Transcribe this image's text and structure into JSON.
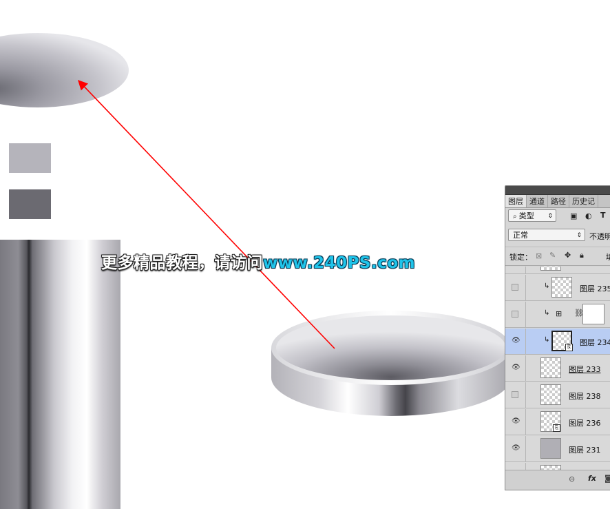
{
  "watermark": {
    "text_cn": "更多精品教程，请访问",
    "text_url": "www.240PS.com",
    "url_color": "#1fc4ea"
  },
  "swatches": [
    {
      "name": "light-gray",
      "color": "#b5b4bb"
    },
    {
      "name": "dark-gray",
      "color": "#6b6a71"
    }
  ],
  "arrow": {
    "color": "#ff0000"
  },
  "layers_panel": {
    "tabs": [
      {
        "label": "图层",
        "active": true
      },
      {
        "label": "通道",
        "active": false
      },
      {
        "label": "路径",
        "active": false
      },
      {
        "label": "历史记",
        "active": false
      }
    ],
    "filter_label": "类型",
    "blend_mode": "正常",
    "opacity_label": "不透明",
    "lock_label": "锁定：",
    "fill_label": "填",
    "layers": [
      {
        "name": "图层 235",
        "visible": false,
        "clipped": true,
        "type": "normal",
        "selected": false,
        "underline": false
      },
      {
        "name": "",
        "visible": false,
        "clipped": true,
        "type": "adjustment",
        "selected": false,
        "underline": false
      },
      {
        "name": "图层 234",
        "visible": true,
        "clipped": true,
        "type": "smart",
        "selected": true,
        "underline": false
      },
      {
        "name": "图层 233",
        "visible": true,
        "clipped": false,
        "type": "normal",
        "selected": false,
        "underline": true
      },
      {
        "name": "图层 238",
        "visible": false,
        "clipped": false,
        "type": "normal",
        "selected": false,
        "underline": false
      },
      {
        "name": "图层 236",
        "visible": true,
        "clipped": false,
        "type": "smart",
        "selected": false,
        "underline": false
      },
      {
        "name": "图层 231",
        "visible": true,
        "clipped": false,
        "type": "gray",
        "selected": false,
        "underline": false
      }
    ],
    "footer_icons": [
      "link-icon",
      "fx-icon",
      "mask-icon"
    ],
    "footer_fx_label": "fx"
  }
}
